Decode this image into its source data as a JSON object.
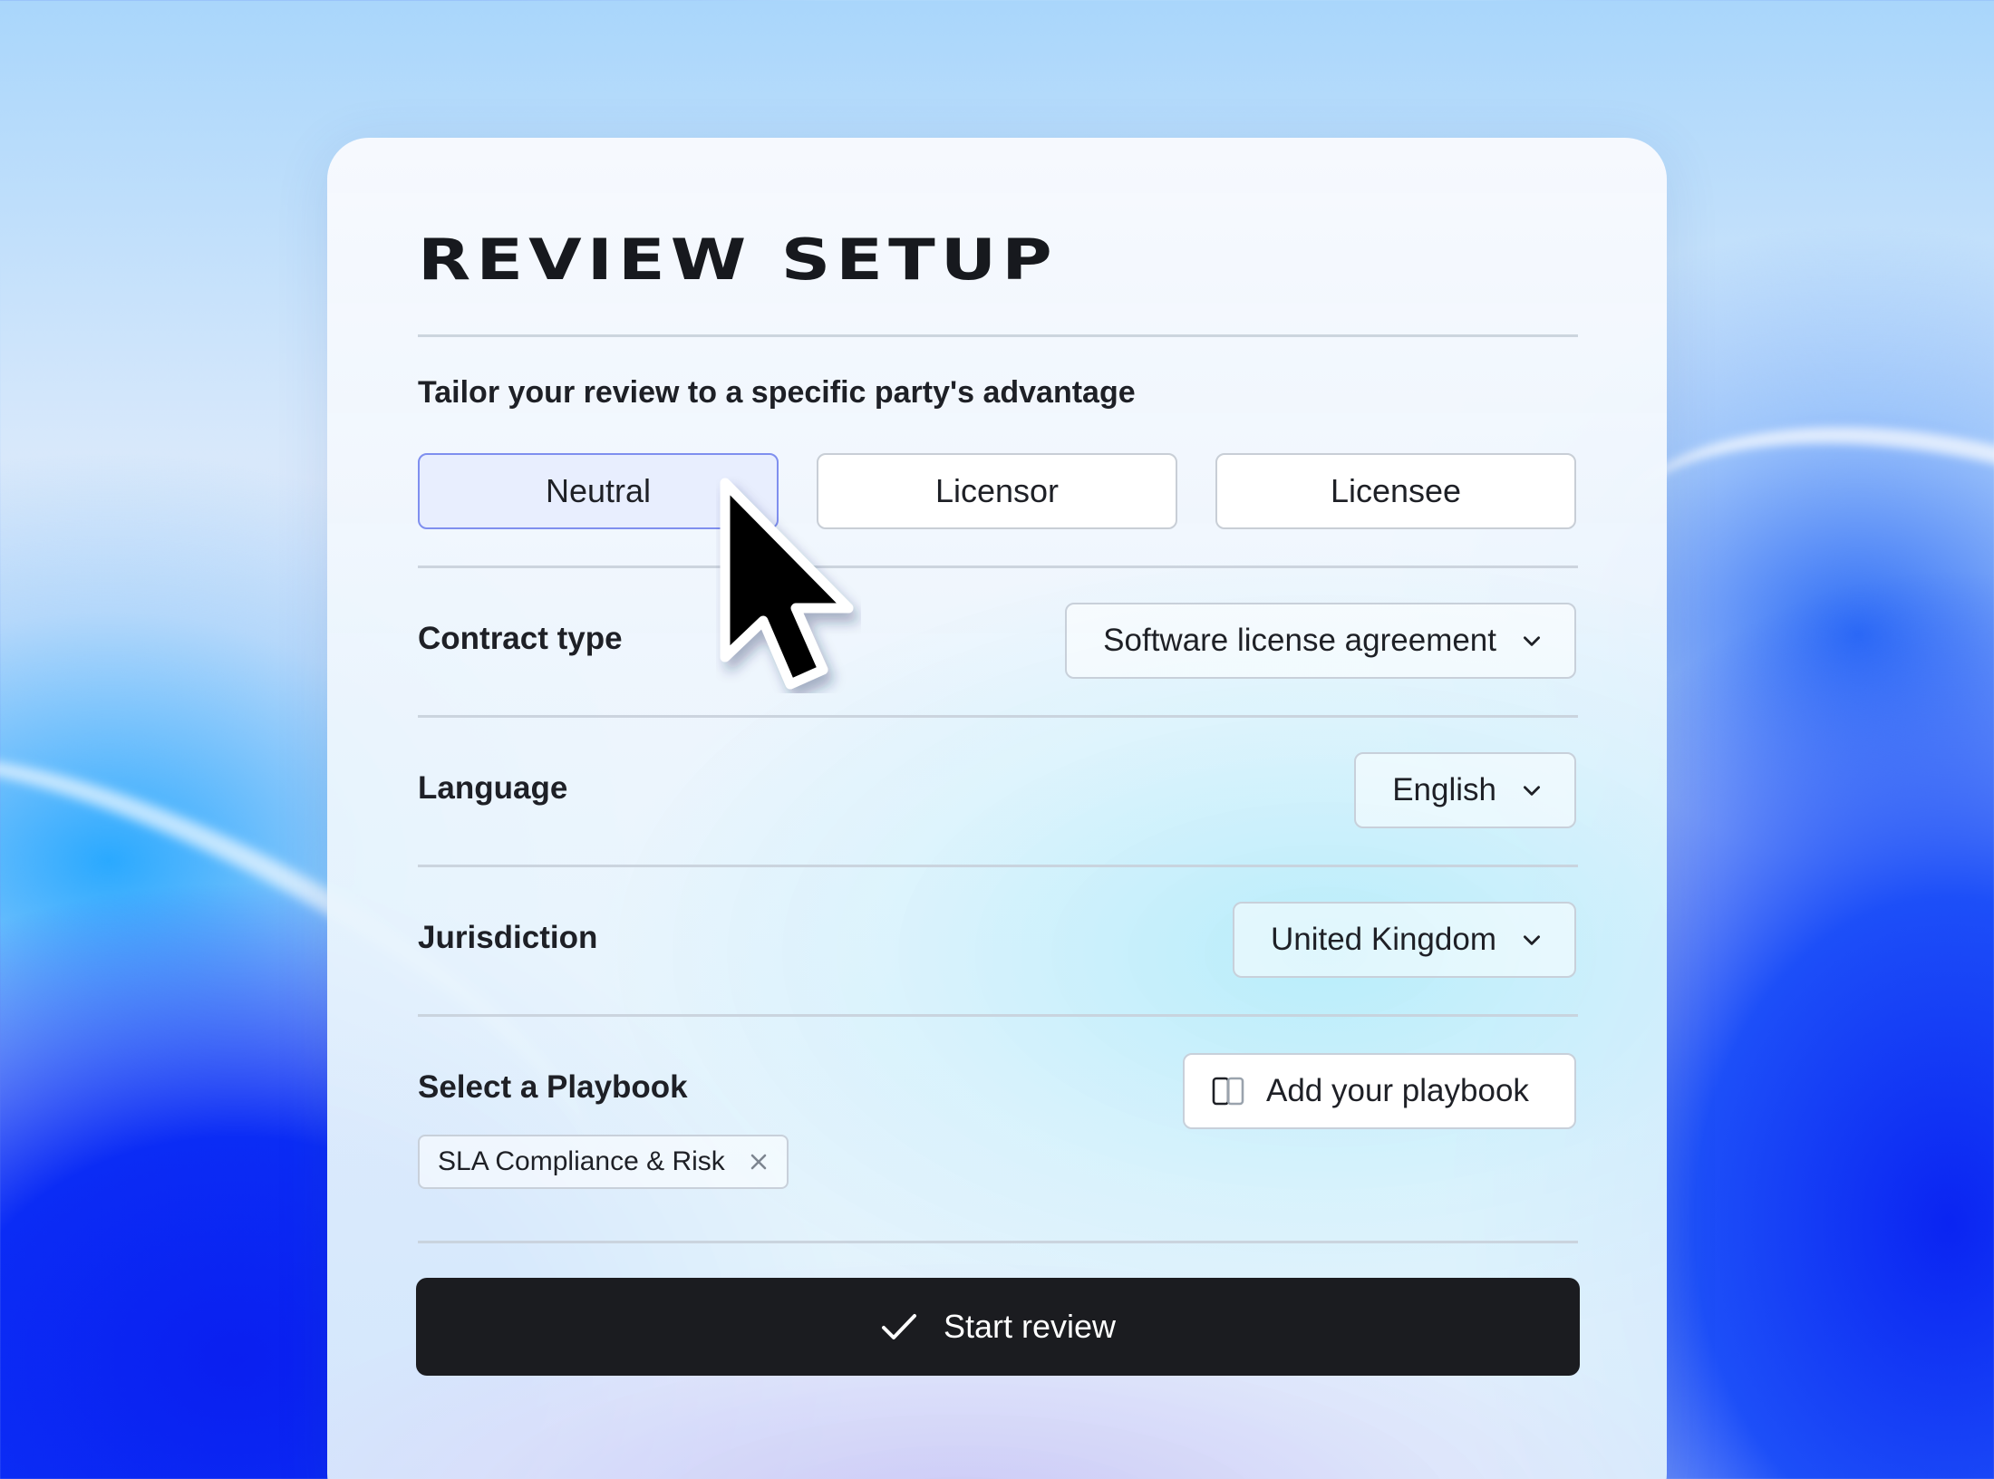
{
  "card": {
    "title": "REVIEW SETUP",
    "subtitle": "Tailor your review to a specific party's advantage"
  },
  "party_options": [
    {
      "label": "Neutral",
      "selected": true
    },
    {
      "label": "Licensor",
      "selected": false
    },
    {
      "label": "Licensee",
      "selected": false
    }
  ],
  "contract_type": {
    "label": "Contract type",
    "value": "Software license agreement",
    "icon": "chevron-down-icon"
  },
  "language": {
    "label": "Language",
    "value": "English",
    "icon": "chevron-down-icon"
  },
  "jurisdiction": {
    "label": "Jurisdiction",
    "value": "United Kingdom",
    "icon": "chevron-down-icon"
  },
  "playbook": {
    "label": "Select a Playbook",
    "add_button": "Add your playbook",
    "add_icon": "book-icon",
    "selected_tag": "SLA Compliance & Risk",
    "remove_icon": "close-icon"
  },
  "start_button": {
    "label": "Start review",
    "icon": "checkmark-icon"
  },
  "colors": {
    "selected_bg": "#e8eefe",
    "selected_border": "#7f8fef",
    "primary_button": "#1b1c20"
  }
}
